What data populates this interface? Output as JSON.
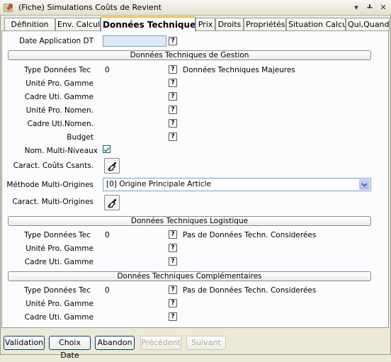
{
  "window": {
    "title": "(Fiche) Simulations Coûts de Revient"
  },
  "tabs": [
    {
      "label": "Définition"
    },
    {
      "label": "Env. Calcul"
    },
    {
      "label": "Données Techniques"
    },
    {
      "label": "Prix"
    },
    {
      "label": "Droits"
    },
    {
      "label": "Propriétés"
    },
    {
      "label": "Situation Calcul"
    },
    {
      "label": "Qui,Quand?"
    }
  ],
  "form": {
    "date_application_label": "Date Application DT",
    "date_application_value": "",
    "help_glyph": "?",
    "gestion": {
      "header": "Données Techniques de Gestion",
      "type_label": "Type Données Tec",
      "type_value": "0",
      "type_desc": "Données Techniques Majeures",
      "unite_pro_gamme_label": "Unité Pro. Gamme",
      "cadre_uti_gamme_label": "Cadre Uti. Gamme",
      "unite_pro_nomen_label": "Unité Pro. Nomen.",
      "cadre_uti_nomen_label": "Cadre Uti.Nomen.",
      "budget_label": "Budget",
      "nom_multi_niveaux_label": "Nom. Multi-Niveaux",
      "nom_multi_niveaux_checked": true,
      "caract_couts_label": "Caract. Coûts Csants.",
      "methode_multi_origines_label": "Méthode Multi-Origines",
      "methode_multi_origines_value": "[0] Origine Principale Article",
      "caract_multi_origines_label": "Caract. Multi-Origines"
    },
    "logistique": {
      "header": "Données Techniques Logistique",
      "type_label": "Type Données Tec",
      "type_value": "0",
      "type_desc": "Pas de Données Techn. Considerées",
      "unite_pro_gamme_label": "Unité Pro. Gamme",
      "cadre_uti_gamme_label": "Cadre Uti. Gamme"
    },
    "complementaires": {
      "header": "Données Techniques Complémentaires",
      "type_label": "Type Données Tec",
      "type_value": "0",
      "type_desc": "Pas de Données Techn. Considerées",
      "unite_pro_gamme_label": "Unité Pro. Gamme",
      "cadre_uti_gamme_label": "Cadre Uti. Gamme"
    }
  },
  "footer": {
    "validation": "Validation",
    "choix_date": "Choix Date",
    "abandon": "Abandon",
    "precedent": "Précédent",
    "suivant": "Suivant"
  }
}
